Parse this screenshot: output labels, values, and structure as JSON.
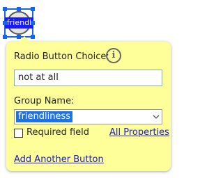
{
  "widget": {
    "tag_text": "friendl",
    "accent_color": "#1565e8"
  },
  "panel": {
    "background_color": "#ffff99",
    "choice_label": "Radio Button Choice:",
    "info_icon_glyph": "i",
    "choice_value": "not at all",
    "group_label": "Group Name:",
    "group_value": "friendliness",
    "required_label": "Required field",
    "required_checked": false,
    "all_properties_link": "All Properties",
    "add_button_link": "Add Another Button",
    "link_color": "#1a1acc"
  }
}
